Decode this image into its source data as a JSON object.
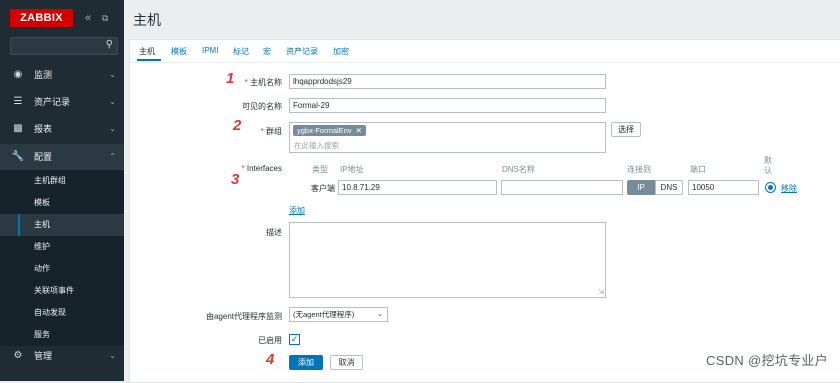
{
  "brand": {
    "logo": "ZABBIX",
    "color": "#d40000"
  },
  "sidebar": {
    "collapse_icon": "«",
    "kiosk_icon": "⧉",
    "search_placeholder": "",
    "items": [
      {
        "label": "监测",
        "icon": "eye-icon"
      },
      {
        "label": "资产记录",
        "icon": "list-icon"
      },
      {
        "label": "报表",
        "icon": "chart-icon"
      },
      {
        "label": "配置",
        "icon": "wrench-icon"
      },
      {
        "label": "管理",
        "icon": "gear-icon"
      }
    ],
    "submenu": [
      "主机群组",
      "模板",
      "主机",
      "维护",
      "动作",
      "关联项事件",
      "自动发现",
      "服务"
    ]
  },
  "page": {
    "title": "主机"
  },
  "tabs": [
    "主机",
    "模板",
    "IPMI",
    "标记",
    "宏",
    "资产记录",
    "加密"
  ],
  "form": {
    "host_name_label": "主机名称",
    "host_name_value": "lhqapprdodsjs29",
    "visible_name_label": "可见的名称",
    "visible_name_value": "Formal-29",
    "groups_label": "群组",
    "group_tag": "ygbx-FormalEnv",
    "groups_placeholder": "在此输入搜索",
    "select_button": "选择",
    "interfaces_label": "Interfaces",
    "interface_headers": {
      "type": "类型",
      "ip": "IP地址",
      "dns": "DNS名称",
      "connect": "连接到",
      "port": "端口",
      "default": "默认"
    },
    "interface_row": {
      "type": "客户端",
      "ip": "10.8.71.29",
      "dns": "",
      "ip_toggle": "IP",
      "dns_toggle": "DNS",
      "port": "10050",
      "remove": "移除"
    },
    "add_link": "添加",
    "description_label": "描述",
    "description_value": "",
    "proxy_label": "由agent代理程序监测",
    "proxy_value": "(无agent代理程序)",
    "enabled_label": "已启用",
    "enabled": true,
    "add_button": "添加",
    "cancel_button": "取消"
  },
  "annotations": [
    "1",
    "2",
    "3",
    "4"
  ],
  "watermark": "CSDN @挖坑专业户",
  "colors": {
    "accent": "#0275b8",
    "sidebar": "#1f2c33",
    "required": "#e33734"
  }
}
